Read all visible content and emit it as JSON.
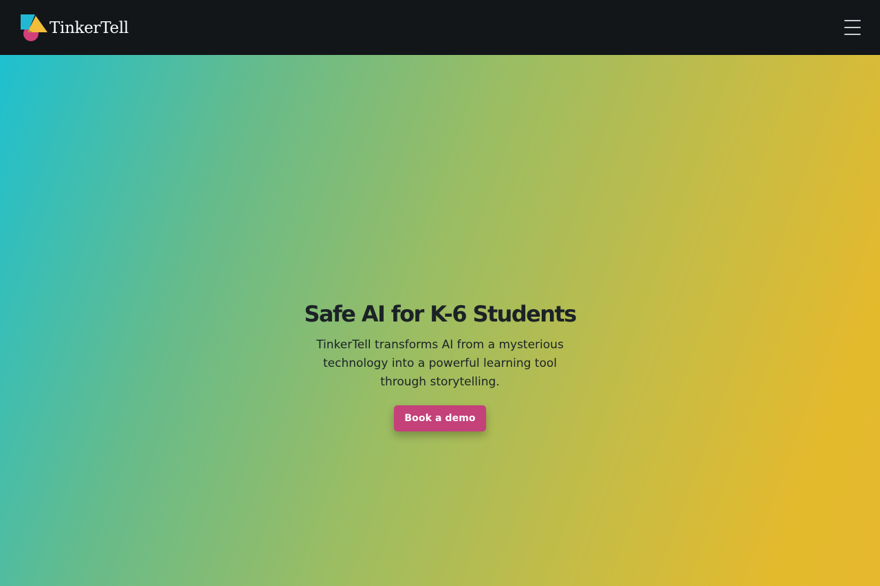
{
  "brand": {
    "name": "TinkerTell",
    "colors": {
      "teal": "#22b8d4",
      "yellow": "#f2be3a",
      "pink": "#d23f7a"
    }
  },
  "nav": {
    "background": "#121619",
    "menu_icon": "hamburger-menu-icon"
  },
  "hero": {
    "title": "Safe AI for K-6 Students",
    "subtitle": "TinkerTell transforms AI from a mysterious technology into a powerful learning tool through storytelling.",
    "cta_label": "Book a demo",
    "cta_color": "#c4417a",
    "gradient": [
      "#1ec0d0",
      "#e6b82d"
    ]
  }
}
